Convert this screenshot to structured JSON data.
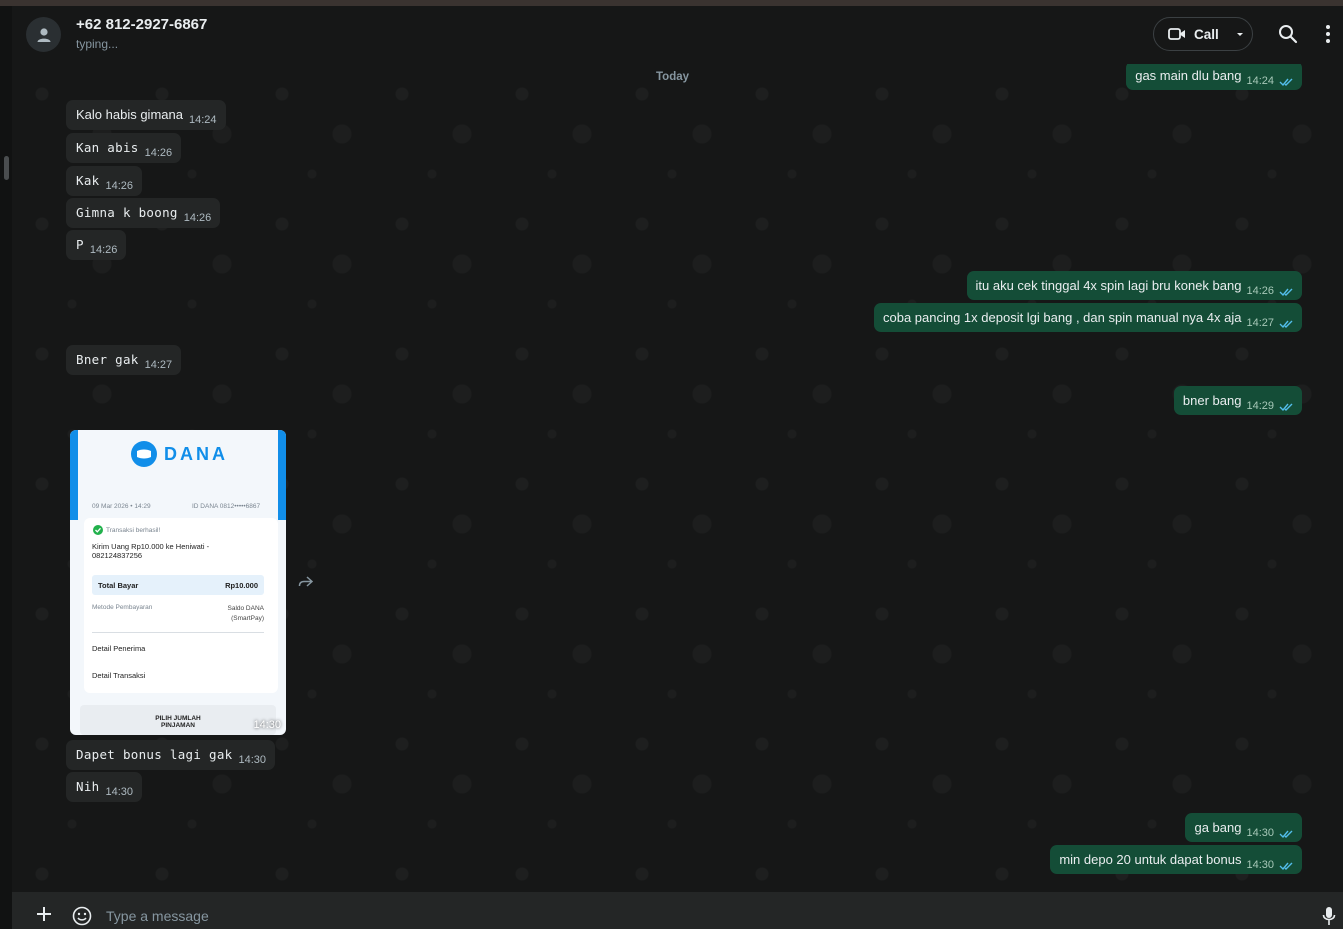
{
  "header": {
    "contact_name": "+62 812-2927-6867",
    "status": "typing...",
    "call_label": "Call"
  },
  "chat": {
    "date_label": "Today",
    "messages": [
      {
        "dir": "out",
        "text": "gas main dlu bang",
        "time": "14:24"
      },
      {
        "dir": "in",
        "text": "Kalo habis gimana",
        "time": "14:24"
      },
      {
        "dir": "in",
        "text": "Kan abis",
        "time": "14:26"
      },
      {
        "dir": "in",
        "text": "Kak",
        "time": "14:26"
      },
      {
        "dir": "in",
        "text": "Gimna k boong",
        "time": "14:26"
      },
      {
        "dir": "in",
        "text": "P",
        "time": "14:26"
      },
      {
        "dir": "out",
        "text": "itu aku cek tinggal 4x spin lagi bru konek bang",
        "time": "14:26"
      },
      {
        "dir": "out",
        "text": "coba pancing 1x deposit lgi bang , dan spin manual nya 4x aja",
        "time": "14:27"
      },
      {
        "dir": "in",
        "text": "Bner gak",
        "time": "14:27"
      },
      {
        "dir": "out",
        "text": "bner bang",
        "time": "14:29"
      },
      {
        "dir": "in",
        "text": "Dapet bonus lagi gak",
        "time": "14:30"
      },
      {
        "dir": "in",
        "text": "Nih",
        "time": "14:30"
      },
      {
        "dir": "out",
        "text": "ga bang",
        "time": "14:30"
      },
      {
        "dir": "out",
        "text": "min depo 20 untuk dapat bonus",
        "time": "14:30"
      }
    ],
    "image_message": {
      "time": "14:30",
      "receipt": {
        "brand": "DANA",
        "date": "09 Mar 2026 • 14:29",
        "dana_id": "ID DANA 0812•••••6867",
        "status": "Transaksi berhasil!",
        "description": "Kirim Uang Rp10.000 ke Heniwati - 082124837256",
        "total_label": "Total Bayar",
        "total_value": "Rp10.000",
        "method_label": "Metode Pembayaran",
        "method_value": "Saldo DANA (SmartPay)",
        "recipient_label": "Detail Penerima",
        "transaction_label": "Detail Transaksi",
        "banner": "PILIH JUMLAH PINJAMAN"
      }
    }
  },
  "footer": {
    "placeholder": "Type a message"
  },
  "colors": {
    "outgoing_bubble": "#144d37",
    "incoming_bubble": "#242626",
    "background": "#161717",
    "dana_blue": "#118ee9",
    "tick_blue": "#53bdeb"
  }
}
